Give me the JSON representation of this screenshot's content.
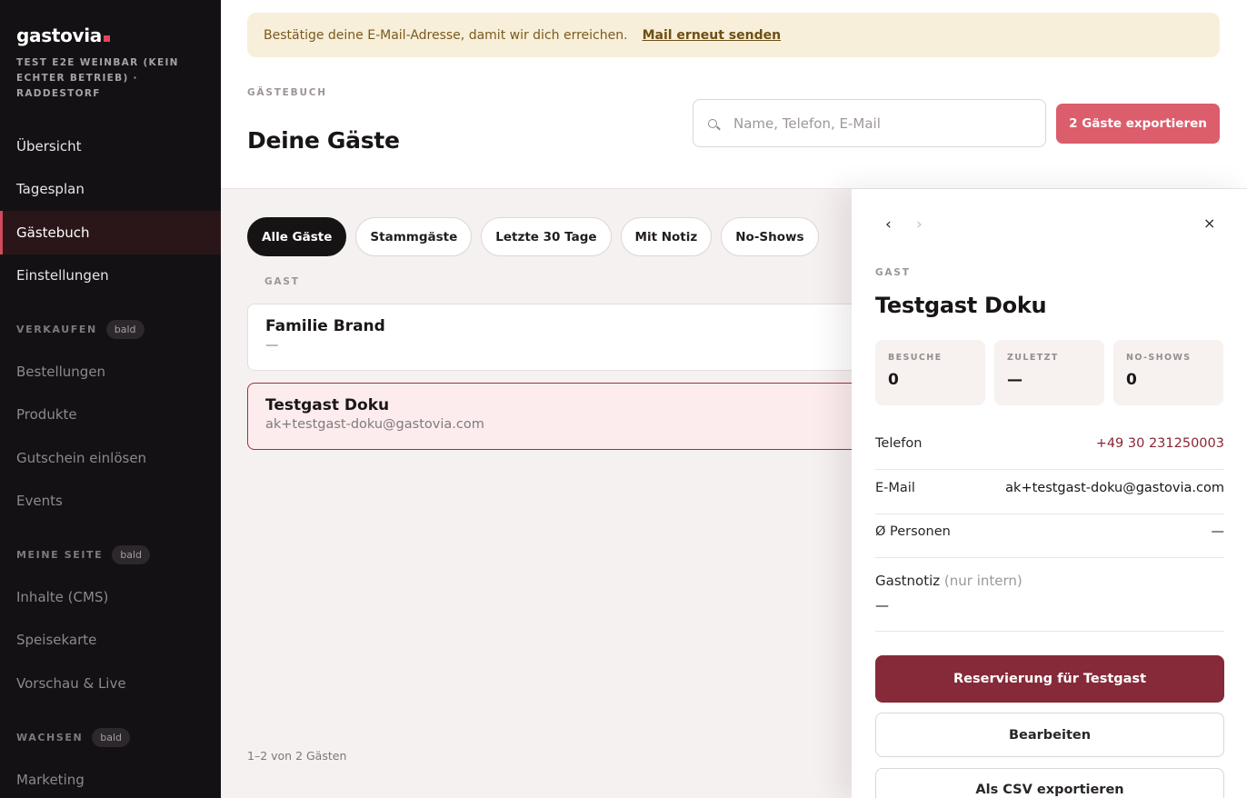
{
  "sidebar": {
    "logo": "gastovia",
    "venue": "TEST E2E WEINBAR (KEIN ECHTER BETRIEB) · RADDESTORF",
    "main_items": [
      {
        "label": "Übersicht"
      },
      {
        "label": "Tagesplan"
      },
      {
        "label": "Gästebuch",
        "active": true
      },
      {
        "label": "Einstellungen"
      }
    ],
    "sections": [
      {
        "label": "VERKAUFEN",
        "badge": "bald",
        "items": [
          "Bestellungen",
          "Produkte",
          "Gutschein einlösen",
          "Events"
        ]
      },
      {
        "label": "MEINE SEITE",
        "badge": "bald",
        "items": [
          "Inhalte (CMS)",
          "Speisekarte",
          "Vorschau & Live"
        ]
      },
      {
        "label": "WACHSEN",
        "badge": "bald",
        "items": [
          "Marketing"
        ]
      }
    ]
  },
  "banner": {
    "text": "Bestätige deine E-Mail-Adresse, damit wir dich erreichen.",
    "link": "Mail erneut senden"
  },
  "header": {
    "eyebrow": "GÄSTEBUCH",
    "title": "Deine Gäste",
    "search_placeholder": "Name, Telefon, E-Mail",
    "export_label": "2 Gäste exportieren"
  },
  "filters": [
    "Alle Gäste",
    "Stammgäste",
    "Letzte 30 Tage",
    "Mit Notiz",
    "No-Shows"
  ],
  "list": {
    "column_header": "GAST",
    "rows": [
      {
        "name": "Familie Brand",
        "sub": "—"
      },
      {
        "name": "Testgast Doku",
        "sub": "ak+testgast-doku@gastovia.com",
        "selected": true
      }
    ],
    "pagination": "1–2 von 2 Gästen"
  },
  "detail": {
    "prev_icon": "‹",
    "next_icon": "›",
    "close_icon": "×",
    "eyebrow": "GAST",
    "name": "Testgast Doku",
    "stats": [
      {
        "label": "BESUCHE",
        "value": "0"
      },
      {
        "label": "ZULETZT",
        "value": "—"
      },
      {
        "label": "NO-SHOWS",
        "value": "0"
      }
    ],
    "phone_label": "Telefon",
    "phone_value": "+49 30 231250003",
    "email_label": "E-Mail",
    "email_value": "ak+testgast-doku@gastovia.com",
    "persons_label": "Ø Personen",
    "persons_value": "—",
    "note_label": "Gastnotiz",
    "note_hint": "(nur intern)",
    "note_value": "—",
    "reserve_label": "Reservierung für Testgast",
    "edit_label": "Bearbeiten",
    "csv_label": "Als CSV exportieren"
  },
  "colors": {
    "accent": "#dc5d6b",
    "primary_dark": "#862a39",
    "sidebar_bg": "#131113"
  }
}
